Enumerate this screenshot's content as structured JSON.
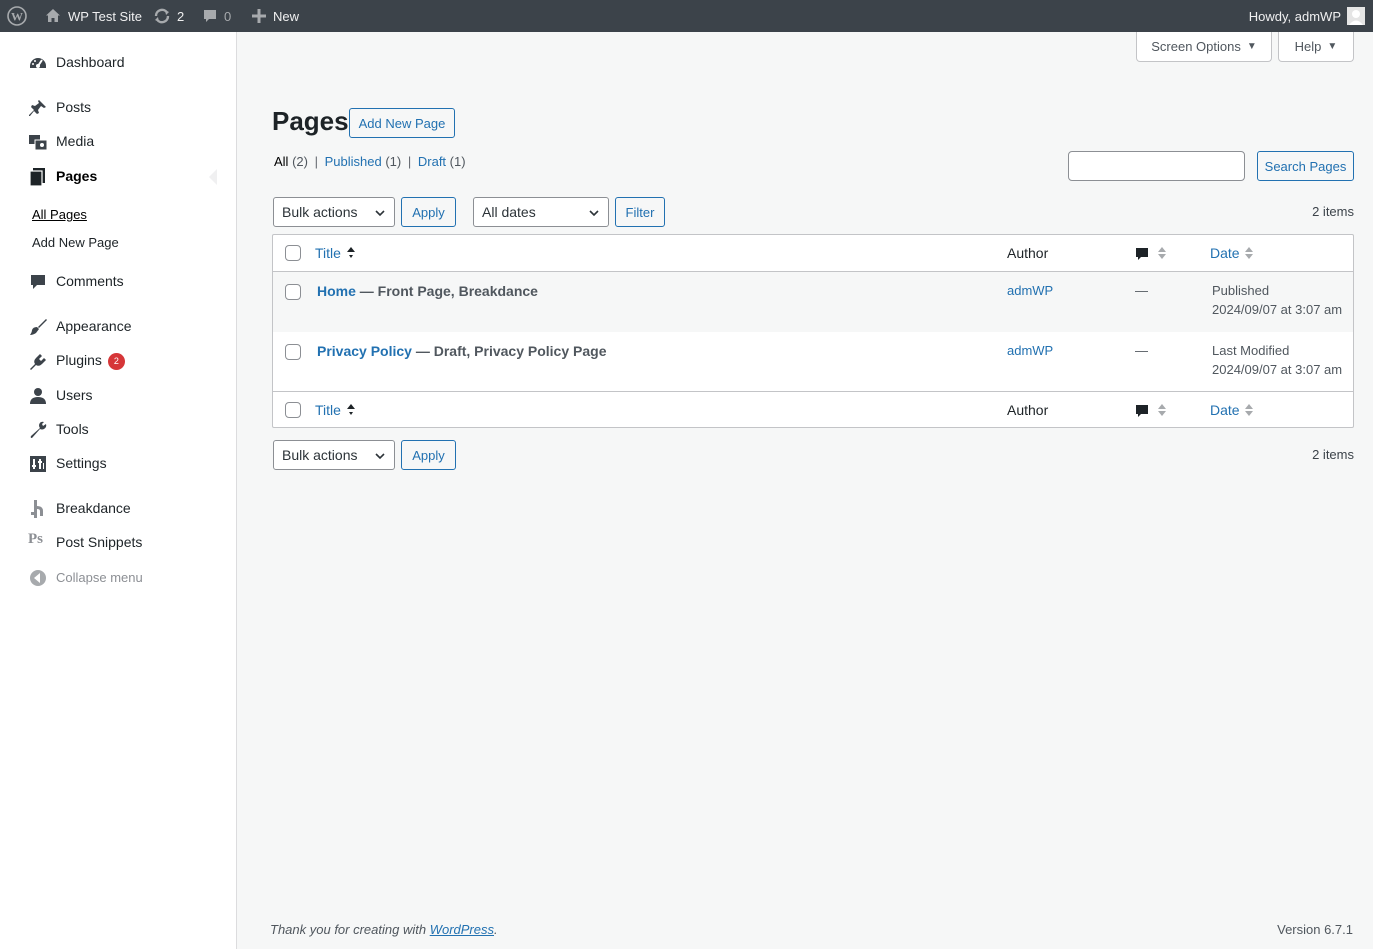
{
  "adminbar": {
    "site_name": "WP Test Site",
    "updates_count": "2",
    "comments_count": "0",
    "new_label": "New",
    "howdy": "Howdy, admWP"
  },
  "sidebar": {
    "items": [
      {
        "label": "Dashboard",
        "icon": "dashboard-icon"
      },
      {
        "label": "Posts",
        "icon": "pin-icon"
      },
      {
        "label": "Media",
        "icon": "media-icon"
      },
      {
        "label": "Pages",
        "icon": "pages-icon"
      },
      {
        "label": "Comments",
        "icon": "comment-icon"
      },
      {
        "label": "Appearance",
        "icon": "brush-icon"
      },
      {
        "label": "Plugins",
        "icon": "plugin-icon",
        "badge": "2"
      },
      {
        "label": "Users",
        "icon": "user-icon"
      },
      {
        "label": "Tools",
        "icon": "wrench-icon"
      },
      {
        "label": "Settings",
        "icon": "settings-icon"
      },
      {
        "label": "Breakdance",
        "icon": "breakdance-icon"
      },
      {
        "label": "Post Snippets",
        "icon": "ps-icon",
        "icon_text": "Ps"
      },
      {
        "label": "Collapse menu",
        "icon": "collapse-icon"
      }
    ],
    "submenu": [
      "All Pages",
      "Add New Page"
    ]
  },
  "header": {
    "screen_options": "Screen Options",
    "help": "Help",
    "title": "Pages",
    "add_new": "Add New Page"
  },
  "filters": {
    "all": "All",
    "all_count": "(2)",
    "published": "Published",
    "published_count": "(1)",
    "draft": "Draft",
    "draft_count": "(1)",
    "separator": "|",
    "search_button": "Search Pages",
    "bulk_actions": "Bulk actions",
    "apply": "Apply",
    "all_dates": "All dates",
    "filter": "Filter",
    "items": "2 items"
  },
  "table": {
    "columns": {
      "title": "Title",
      "author": "Author",
      "date": "Date"
    },
    "rows": [
      {
        "title": "Home",
        "state": " — Front Page, Breakdance",
        "author": "admWP",
        "comments": "—",
        "status": "Published",
        "date": "2024/09/07 at 3:07 am"
      },
      {
        "title": "Privacy Policy",
        "state": " — Draft, Privacy Policy Page",
        "author": "admWP",
        "comments": "—",
        "status": "Last Modified",
        "date": "2024/09/07 at 3:07 am"
      }
    ]
  },
  "footer": {
    "thanks": "Thank you for creating with ",
    "wp_link": "WordPress",
    "period": ".",
    "version": "Version 6.7.1"
  },
  "colors": {
    "accent": "#2271b1",
    "adminbar": "#3c434a",
    "badge": "#d63638"
  }
}
